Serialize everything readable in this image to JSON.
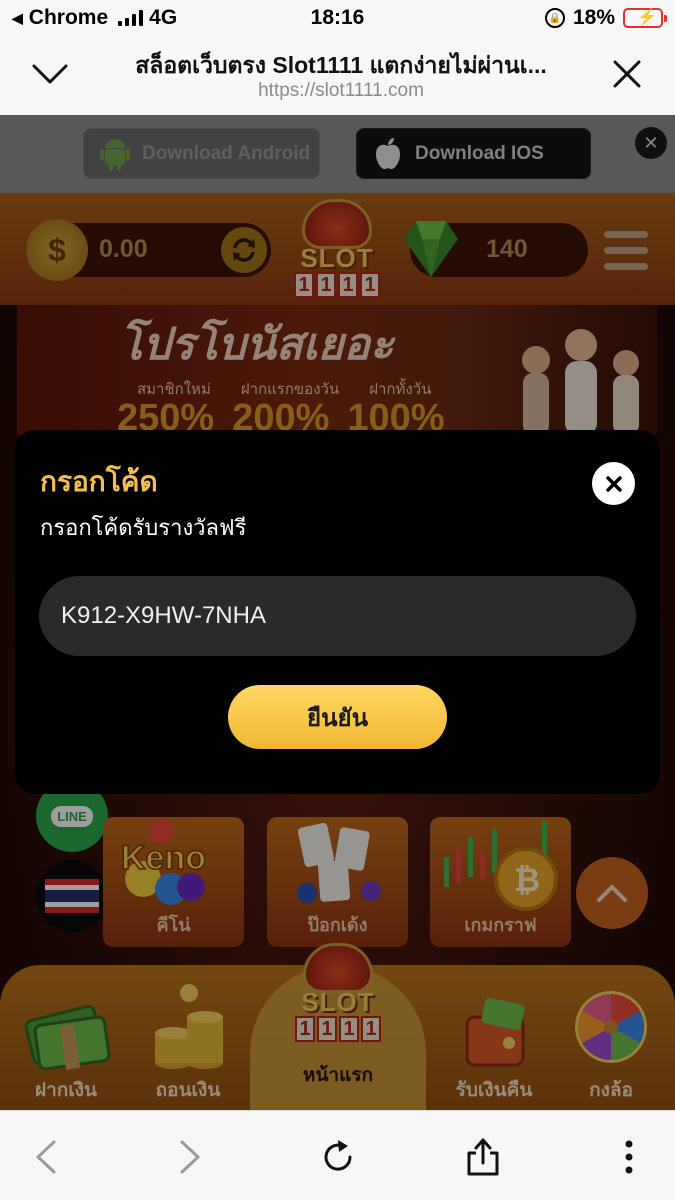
{
  "status_bar": {
    "carrier": "Chrome",
    "network": "4G",
    "time": "18:16",
    "battery": "18%",
    "battery_level": 0.18
  },
  "browser": {
    "title": "สล็อตเว็บตรง Slot1111 แตกง่ายไม่ผ่านเ...",
    "url": "https://slot1111.com"
  },
  "download_bar": {
    "android_label": "Download Android",
    "ios_label": "Download IOS"
  },
  "header": {
    "balance": "0.00",
    "gems": "140",
    "logo_word": "SLOT",
    "logo_digits": [
      "1",
      "1",
      "1",
      "1"
    ]
  },
  "banner": {
    "title": "โปรโบนัสเยอะ",
    "subtitles": [
      "สมาชิกใหม่",
      "ฝากแรกของวัน",
      "ฝากทั้งวัน"
    ],
    "percents": [
      "250%",
      "200%",
      "100%"
    ]
  },
  "floating": {
    "line_label": "LINE"
  },
  "categories": [
    {
      "label": "คีโน่"
    },
    {
      "label": "ป๊อกเด้ง"
    },
    {
      "label": "เกมกราฟ"
    }
  ],
  "bottom_nav": {
    "items": [
      {
        "label": "ฝากเงิน"
      },
      {
        "label": "ถอนเงิน"
      },
      {
        "label": "หน้าแรก"
      },
      {
        "label": "รับเงินคืน"
      },
      {
        "label": "กงล้อ"
      }
    ]
  },
  "modal": {
    "title": "กรอกโค้ด",
    "subtitle": "กรอกโค้ดรับรางวัลฟรี",
    "code_value": "K912-X9HW-7NHA",
    "confirm_label": "ยืนยัน"
  },
  "colors": {
    "accent_gold": "#f2c04c",
    "button_gold": "#f2b733",
    "modal_bg": "#000000",
    "input_bg": "#2a2a2a"
  }
}
